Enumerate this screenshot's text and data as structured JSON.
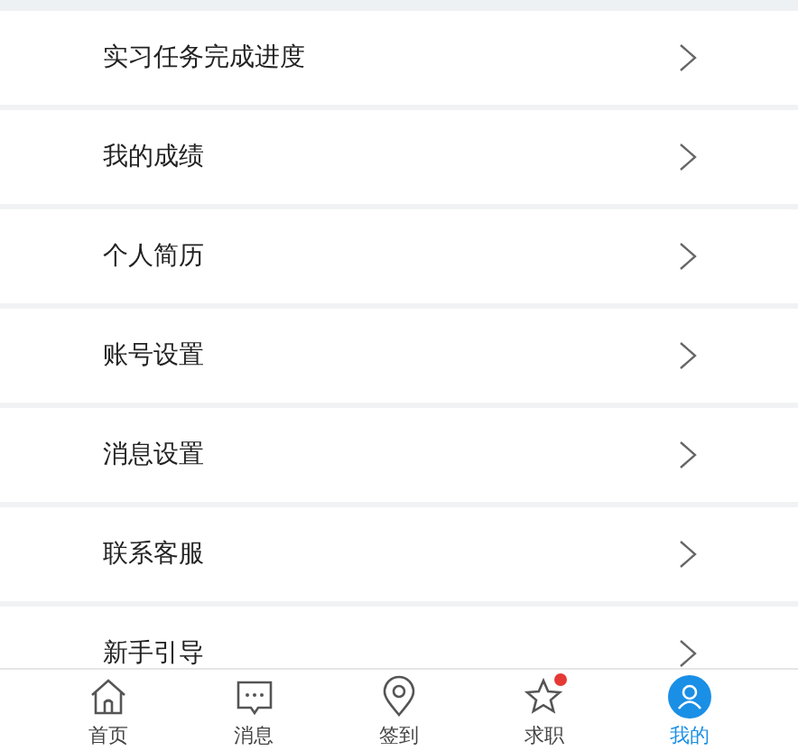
{
  "menu": [
    {
      "label": "实习任务完成进度"
    },
    {
      "label": "我的成绩"
    },
    {
      "label": "个人简历"
    },
    {
      "label": "账号设置"
    },
    {
      "label": "消息设置"
    },
    {
      "label": "联系客服"
    },
    {
      "label": "新手引导"
    }
  ],
  "tab_bar": [
    {
      "label": "首页",
      "kind": "home",
      "selected": false,
      "dot": false
    },
    {
      "label": "消息",
      "kind": "message",
      "selected": false,
      "dot": false
    },
    {
      "label": "签到",
      "kind": "location",
      "selected": false,
      "dot": false
    },
    {
      "label": "求职",
      "kind": "star",
      "selected": false,
      "dot": true
    },
    {
      "label": "我的",
      "kind": "person",
      "selected": true,
      "dot": false
    }
  ]
}
